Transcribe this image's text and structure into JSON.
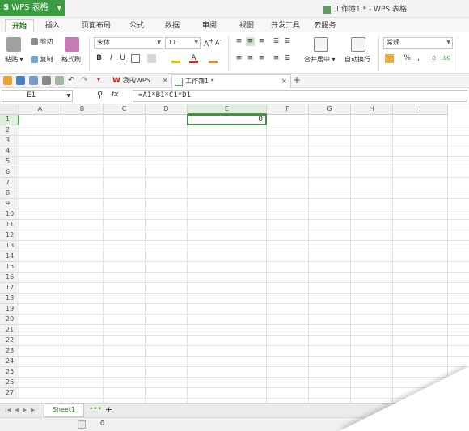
{
  "app": {
    "name": "WPS 表格",
    "window_title": "工作簿1 * - WPS 表格"
  },
  "ribbon_tabs": [
    "开始",
    "插入",
    "页面布局",
    "公式",
    "数据",
    "审阅",
    "视图",
    "开发工具",
    "云服务"
  ],
  "ribbon": {
    "paste": "粘贴",
    "cut": "剪切",
    "copy": "复制",
    "format_painter": "格式刷",
    "font_name": "宋体",
    "font_size": "11",
    "bold": "B",
    "italic": "I",
    "underline": "U",
    "merge_center": "合并居中",
    "wrap_text": "自动换行",
    "number_format": "常规",
    "percent": "%",
    "comma": ","
  },
  "doc_tabs": [
    {
      "label": "我的WPS"
    },
    {
      "label": "工作簿1 *"
    }
  ],
  "formula_bar": {
    "cell_ref": "E1",
    "fx": "fx",
    "formula": "=A1*B1*C1*D1"
  },
  "sheet": {
    "columns": [
      "A",
      "B",
      "C",
      "D",
      "E",
      "F",
      "G",
      "H",
      "I"
    ],
    "rows": [
      "1",
      "2",
      "3",
      "4",
      "5",
      "6",
      "7",
      "8",
      "9",
      "10",
      "11",
      "12",
      "13",
      "14",
      "15",
      "16",
      "17",
      "18",
      "19",
      "20",
      "21",
      "22",
      "23",
      "24",
      "25",
      "26",
      "27"
    ],
    "selected_column": "E",
    "selected_row": "1",
    "active_cell_value": "0"
  },
  "sheet_tabs": [
    "Sheet1"
  ],
  "status": {
    "value": "0"
  },
  "colors": {
    "accent": "#3c9b41",
    "selection": "#3f8f3f",
    "header_bg": "#f2f2f2"
  }
}
